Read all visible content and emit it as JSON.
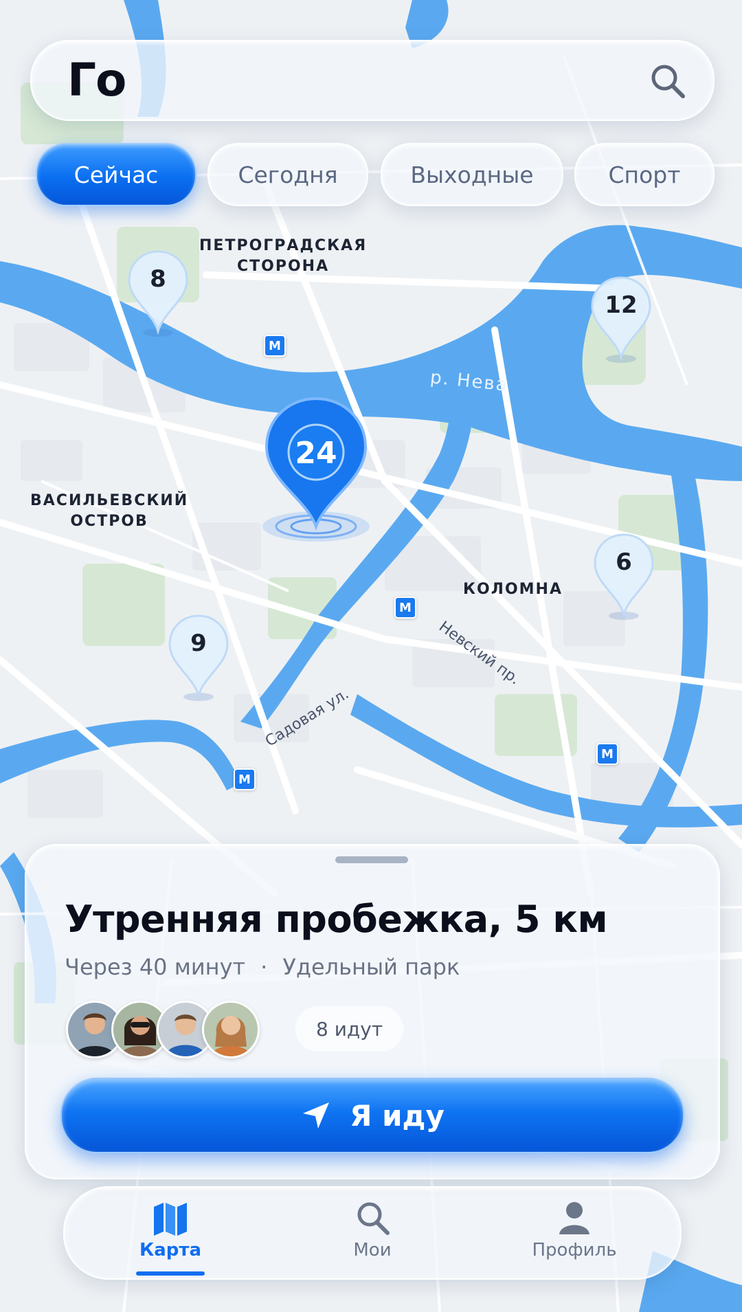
{
  "app": {
    "title": "Го"
  },
  "search": {
    "icon": "search-icon"
  },
  "filters": [
    {
      "label": "Сейчас",
      "active": true
    },
    {
      "label": "Сегодня",
      "active": false
    },
    {
      "label": "Выходные",
      "active": false
    },
    {
      "label": "Спорт",
      "active": false
    }
  ],
  "map": {
    "districts": {
      "petrogradskaya_1": "ПЕТРОГРАДСКАЯ",
      "petrogradskaya_2": "СТОРОНА",
      "vasilievsky_1": "ВАСИЛЬЕВСКИЙ",
      "vasilievsky_2": "ОСТРОВ",
      "kolomna": "КОЛОМНА"
    },
    "river": "р. Нева",
    "streets": {
      "nevsky": "Невский пр.",
      "sadovaya": "Садовая ул."
    },
    "metro_symbol": "М",
    "pins": {
      "p1": "8",
      "p2": "12",
      "main": "24",
      "p3": "6",
      "p4": "9"
    }
  },
  "event": {
    "title": "Утренняя пробежка, 5 км",
    "time": "Через 40 минут",
    "separator": "·",
    "place": "Удельный парк",
    "going": "8 идут",
    "button_label": "Я иду"
  },
  "tabs": [
    {
      "label": "Карта",
      "icon": "map-icon",
      "active": true
    },
    {
      "label": "Мои",
      "icon": "search-icon",
      "active": false
    },
    {
      "label": "Профиль",
      "icon": "person-icon",
      "active": false
    }
  ],
  "colors": {
    "accent": "#0f6ef0",
    "water": "#5aa9f0",
    "land": "#eef1f4",
    "park": "#d3e6d3"
  }
}
